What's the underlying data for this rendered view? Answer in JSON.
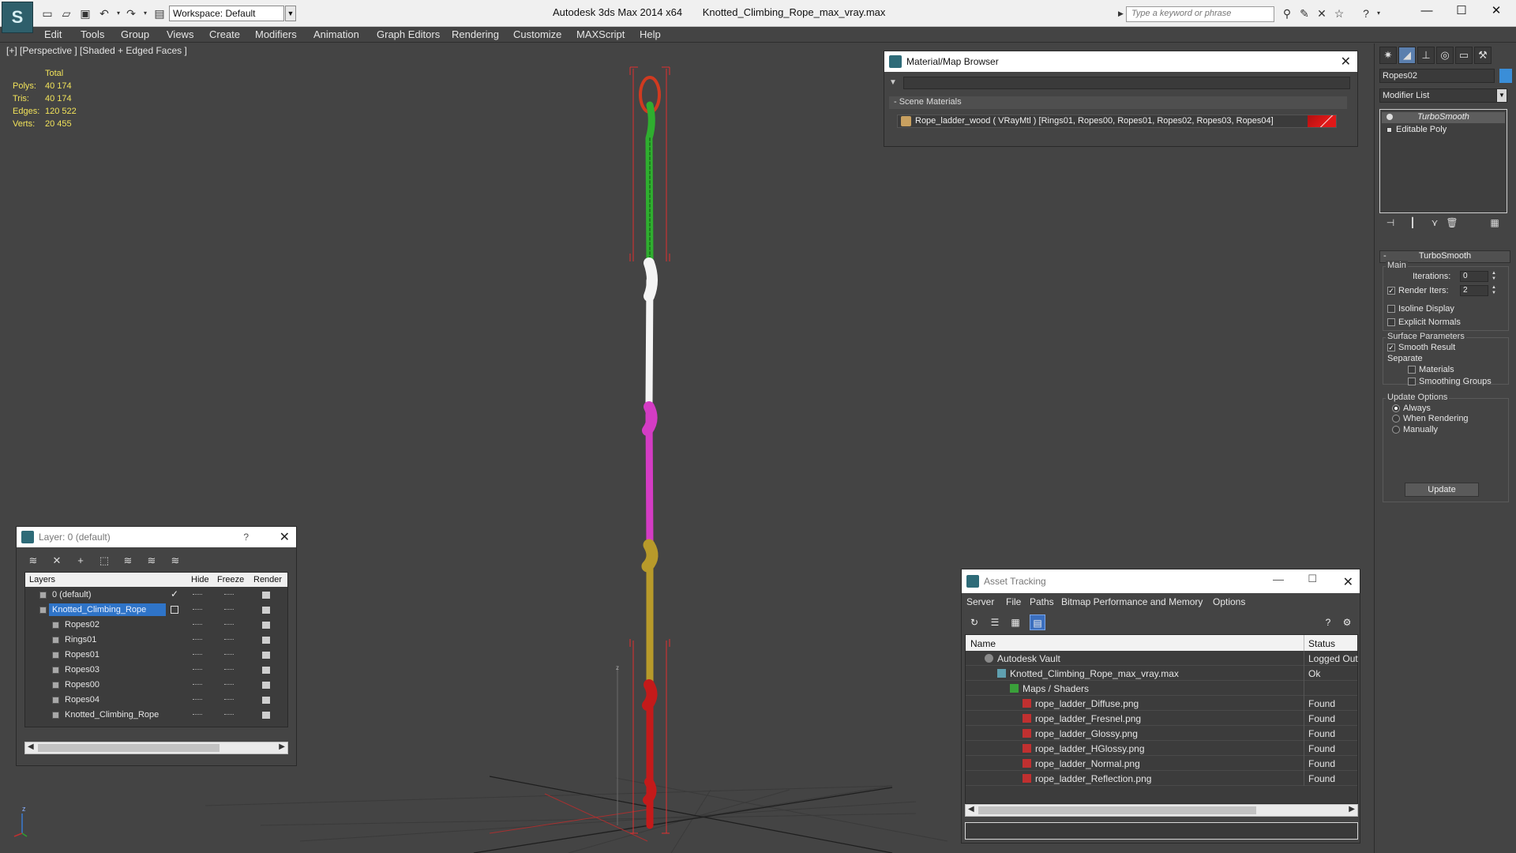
{
  "app": {
    "title": "Autodesk 3ds Max  2014 x64",
    "file": "Knotted_Climbing_Rope_max_vray.max",
    "workspace": "Workspace: Default",
    "search_placeholder": "Type a keyword or phrase"
  },
  "menu": [
    "Edit",
    "Tools",
    "Group",
    "Views",
    "Create",
    "Modifiers",
    "Animation",
    "Graph Editors",
    "Rendering",
    "Customize",
    "MAXScript",
    "Help"
  ],
  "viewport": {
    "label": "[+] [Perspective ] [Shaded + Edged Faces ]",
    "stats": {
      "header": "Total",
      "rows": [
        {
          "label": "Polys:",
          "value": "40 174"
        },
        {
          "label": "Tris:",
          "value": "40 174"
        },
        {
          "label": "Edges:",
          "value": "120 522"
        },
        {
          "label": "Verts:",
          "value": "20 455"
        }
      ]
    },
    "axis_label": "z"
  },
  "material_browser": {
    "title": "Material/Map Browser",
    "section": "- Scene Materials",
    "material": "Rope_ladder_wood  ( VRayMtl )  [Rings01, Ropes00, Ropes01, Ropes02, Ropes03, Ropes04]"
  },
  "command_panel": {
    "object_name": "Ropes02",
    "object_color": "#3a8ed8",
    "modifier_list": "Modifier List",
    "stack": [
      "TurboSmooth",
      "Editable Poly"
    ],
    "rollout": "TurboSmooth",
    "main_group": "Main",
    "iterations_label": "Iterations:",
    "iterations_value": "0",
    "render_iters_label": "Render Iters:",
    "render_iters_value": "2",
    "isoline": "Isoline Display",
    "explicit_normals": "Explicit Normals",
    "surface_group": "Surface Parameters",
    "smooth_result": "Smooth Result",
    "separate": "Separate",
    "materials": "Materials",
    "smoothing_groups": "Smoothing Groups",
    "update_group": "Update Options",
    "always": "Always",
    "when_rendering": "When Rendering",
    "manually": "Manually",
    "update_button": "Update"
  },
  "layer_manager": {
    "title": "Layer: 0 (default)",
    "help": "?",
    "columns": [
      "Layers",
      "Hide",
      "Freeze",
      "Render"
    ],
    "rows": [
      "0 (default)",
      "Knotted_Climbing_Rope",
      "Ropes02",
      "Rings01",
      "Ropes01",
      "Ropes03",
      "Ropes00",
      "Ropes04",
      "Knotted_Climbing_Rope"
    ]
  },
  "asset_tracking": {
    "title": "Asset Tracking",
    "menu": [
      "Server",
      "File",
      "Paths",
      "Bitmap Performance and Memory",
      "Options"
    ],
    "columns": [
      "Name",
      "Status"
    ],
    "rows": [
      {
        "name": "Autodesk Vault",
        "status": "Logged Out"
      },
      {
        "name": "Knotted_Climbing_Rope_max_vray.max",
        "status": "Ok"
      },
      {
        "name": "Maps / Shaders",
        "status": ""
      },
      {
        "name": "rope_ladder_Diffuse.png",
        "status": "Found"
      },
      {
        "name": "rope_ladder_Fresnel.png",
        "status": "Found"
      },
      {
        "name": "rope_ladder_Glossy.png",
        "status": "Found"
      },
      {
        "name": "rope_ladder_HGlossy.png",
        "status": "Found"
      },
      {
        "name": "rope_ladder_Normal.png",
        "status": "Found"
      },
      {
        "name": "rope_ladder_Reflection.png",
        "status": "Found"
      }
    ]
  },
  "colors": {
    "rope_green": "#2fae2f",
    "rope_white": "#f4f4f4",
    "rope_magenta": "#d43cc4",
    "rope_gold": "#b89a2a",
    "rope_red": "#c41a1a",
    "selection_red": "#e03030",
    "accent_blue": "#2f74c8"
  }
}
